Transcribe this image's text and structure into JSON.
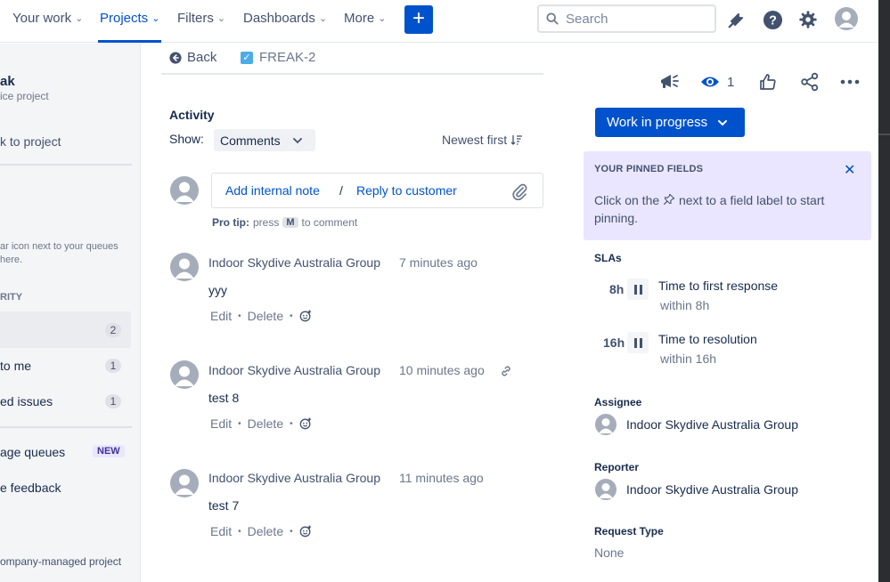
{
  "nav": {
    "items": [
      {
        "label": "Your work"
      },
      {
        "label": "Projects"
      },
      {
        "label": "Filters"
      },
      {
        "label": "Dashboards"
      },
      {
        "label": "More"
      }
    ],
    "create_label": "+",
    "search_placeholder": "Search"
  },
  "sidebar": {
    "project_name": "ak",
    "project_type": "ice project",
    "back_link": "k to project",
    "hint_line1": "ar icon next to your queues",
    "hint_line2": "here.",
    "section_label": "RITY",
    "selected_count": "2",
    "items": [
      {
        "label": "to me",
        "count": "1"
      },
      {
        "label": "ed issues",
        "count": "1"
      }
    ],
    "manage_queues": "age queues",
    "new_badge": "NEW",
    "feedback": "e feedback",
    "footer": "ompany-managed project"
  },
  "issue": {
    "back_label": "Back",
    "key": "FREAK-2"
  },
  "activity": {
    "title": "Activity",
    "show_label": "Show:",
    "show_value": "Comments",
    "sort_label": "Newest first",
    "add_internal_note": "Add internal note",
    "slash": "/",
    "reply_to_customer": "Reply to customer",
    "protip_prefix": "Pro tip:",
    "protip_press": "press",
    "protip_key": "M",
    "protip_suffix": "to comment"
  },
  "comments": [
    {
      "author": "Indoor Skydive Australia Group",
      "time": "7 minutes ago",
      "body": "yyy",
      "edit": "Edit",
      "delete": "Delete"
    },
    {
      "author": "Indoor Skydive Australia Group",
      "time": "10 minutes ago",
      "body": "test 8",
      "edit": "Edit",
      "delete": "Delete"
    },
    {
      "author": "Indoor Skydive Australia Group",
      "time": "11 minutes ago",
      "body": "test 7",
      "edit": "Edit",
      "delete": "Delete"
    }
  ],
  "toolbar": {
    "watch_count": "1"
  },
  "status": {
    "label": "Work in progress"
  },
  "pinned": {
    "title": "YOUR PINNED FIELDS",
    "text_before": "Click on the",
    "text_after": "next to a field label to start pinning."
  },
  "slas": {
    "label": "SLAs",
    "items": [
      {
        "time": "8h",
        "name": "Time to first response",
        "sub": "within 8h"
      },
      {
        "time": "16h",
        "name": "Time to resolution",
        "sub": "within 16h"
      }
    ]
  },
  "fields": {
    "assignee_label": "Assignee",
    "assignee_value": "Indoor Skydive Australia Group",
    "reporter_label": "Reporter",
    "reporter_value": "Indoor Skydive Australia Group",
    "request_type_label": "Request Type",
    "request_type_value": "None"
  },
  "colors": {
    "brand": "#0052cc",
    "pinned_bg": "#eae6ff",
    "avatar": "#a5adba"
  }
}
